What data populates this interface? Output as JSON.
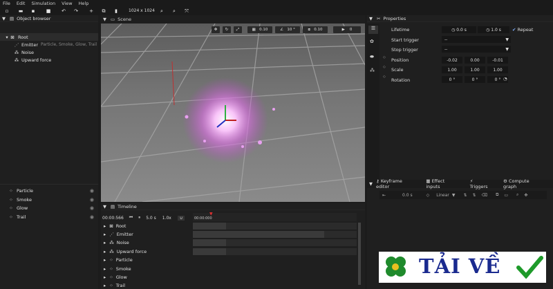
{
  "menu": [
    "File",
    "Edit",
    "Simulation",
    "View",
    "Help"
  ],
  "toolbar": {
    "resolution": "1024 x 1024"
  },
  "object_browser": {
    "title": "Object browser",
    "tree": [
      {
        "label": "Root",
        "sub": ""
      },
      {
        "label": "Emitter",
        "sub": "Particle, Smoke, Glow, Trail"
      },
      {
        "label": "Noise",
        "sub": ""
      },
      {
        "label": "Upward force",
        "sub": ""
      }
    ],
    "layers": [
      "Particle",
      "Smoke",
      "Glow",
      "Trail"
    ]
  },
  "scene": {
    "title": "Scene",
    "grid_snap": "0.10",
    "angle_snap": "10 °",
    "scale_snap": "0.10",
    "camera": "0"
  },
  "properties": {
    "title": "Properties",
    "lifetime_label": "Lifetime",
    "lifetime_a": "0.0 s",
    "lifetime_b": "1.0 s",
    "repeat_label": "Repeat",
    "start_trigger_label": "Start trigger",
    "start_trigger_value": "--",
    "stop_trigger_label": "Stop trigger",
    "stop_trigger_value": "--",
    "position_label": "Position",
    "position": [
      "-0.02",
      "0.00",
      "-0.01"
    ],
    "scale_label": "Scale",
    "scale": [
      "1.00",
      "1.00",
      "1.00"
    ],
    "rotation_label": "Rotation",
    "rotation": [
      "0 °",
      "0 °",
      "0 °"
    ]
  },
  "keyframe": {
    "tabs": [
      "Keyframe editor",
      "Effect inputs",
      "Triggers",
      "Compute graph"
    ],
    "time": "0.0 s",
    "interp": "Linear"
  },
  "timeline": {
    "title": "Timeline",
    "current_time": "00:00:566",
    "duration": "5.0 s",
    "speed": "1.0x",
    "ruler_start": "00:00:000",
    "rows": [
      "Root",
      "Emitter",
      "Noise",
      "Upward force",
      "Particle",
      "Smoke",
      "Glow",
      "Trail"
    ]
  },
  "banner": {
    "text": "TẢI VỀ"
  }
}
